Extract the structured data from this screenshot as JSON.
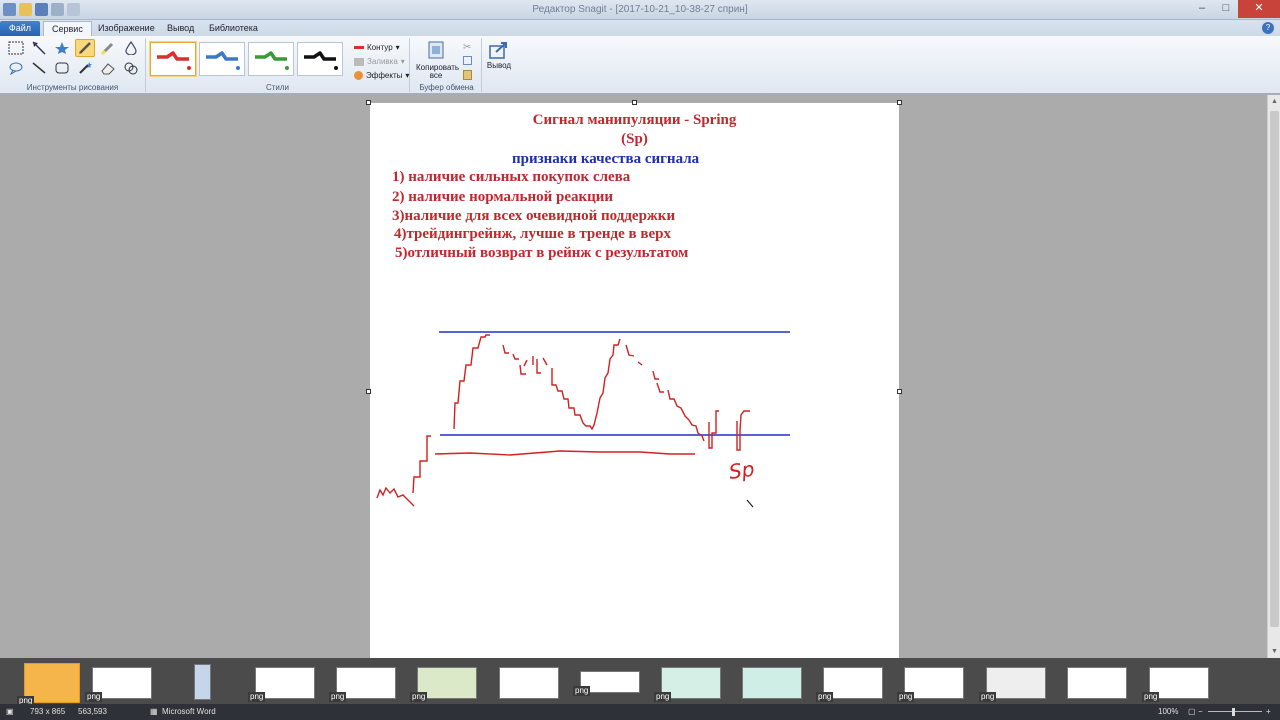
{
  "window": {
    "title": "Редактор Snagit - [2017-10-21_10-38-27 сприн]"
  },
  "tabs": [
    {
      "label": "Файл"
    },
    {
      "label": "Сервис"
    },
    {
      "label": "Изображение"
    },
    {
      "label": "Вывод"
    },
    {
      "label": "Библиотека"
    }
  ],
  "ribbon": {
    "tools_group": "Инструменты рисования",
    "styles_group": "Стили",
    "style_colors": [
      "#d9302c",
      "#3b78c8",
      "#3a9a36",
      "#111111"
    ],
    "outline_label": "Контур",
    "fill_label": "Заливка",
    "effects_label": "Эффекты",
    "copy_all_line1": "Копировать",
    "copy_all_line2": "все",
    "clipboard_group": "Буфер обмена",
    "output_label": "Вывод"
  },
  "document": {
    "title_line1": "Сигнал манипуляции - Spring",
    "title_line2": "(Sp)",
    "subtitle": "признаки качества сигнала",
    "items": [
      "1) наличие сильных покупок слева",
      "2) наличие нормальной реакции",
      "3)наличие для всех очевидной поддержки",
      "4)трейдингрейнж, лучше в  тренде в верх",
      "5)отличный возврат в рейнж с результатом"
    ],
    "sketch_label": "Sp"
  },
  "thumbnails": {
    "tag": "png"
  },
  "status": {
    "dimensions": "793 x 865",
    "cursor": "563,593",
    "app": "Microsoft Word",
    "zoom": "100%"
  }
}
